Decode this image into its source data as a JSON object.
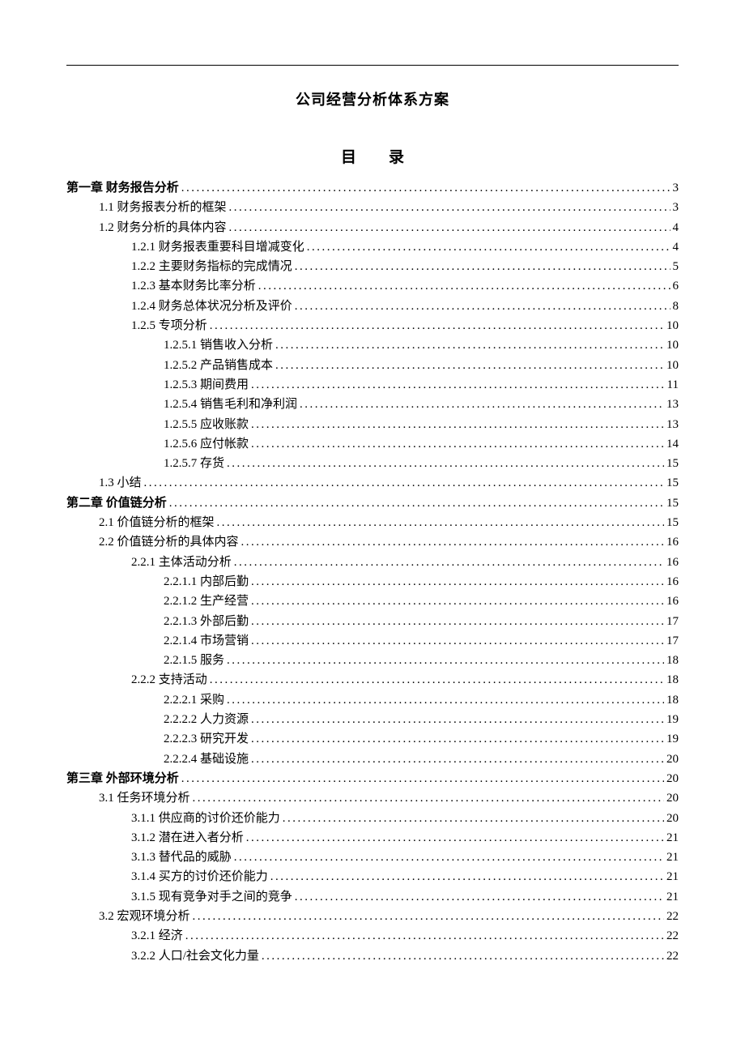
{
  "doc_title": "公司经营分析体系方案",
  "toc_heading_left": "目",
  "toc_heading_right": "录",
  "entries": [
    {
      "level": 0,
      "chap": true,
      "label": "第一章 财务报告分析",
      "page": "3"
    },
    {
      "level": 1,
      "chap": false,
      "label": "1.1 财务报表分析的框架",
      "page": "3"
    },
    {
      "level": 1,
      "chap": false,
      "label": "1.2 财务分析的具体内容",
      "page": "4"
    },
    {
      "level": 2,
      "chap": false,
      "label": "1.2.1 财务报表重要科目增减变化",
      "page": "4"
    },
    {
      "level": 2,
      "chap": false,
      "label": "1.2.2 主要财务指标的完成情况",
      "page": "5"
    },
    {
      "level": 2,
      "chap": false,
      "label": "1.2.3 基本财务比率分析",
      "page": "6"
    },
    {
      "level": 2,
      "chap": false,
      "label": "1.2.4 财务总体状况分析及评价",
      "page": "8"
    },
    {
      "level": 2,
      "chap": false,
      "label": "1.2.5 专项分析",
      "page": "10"
    },
    {
      "level": 3,
      "chap": false,
      "label": "1.2.5.1 销售收入分析",
      "page": "10"
    },
    {
      "level": 3,
      "chap": false,
      "label": "1.2.5.2 产品销售成本",
      "page": "10"
    },
    {
      "level": 3,
      "chap": false,
      "label": "1.2.5.3 期间费用",
      "page": "11"
    },
    {
      "level": 3,
      "chap": false,
      "label": "1.2.5.4 销售毛利和净利润",
      "page": "13"
    },
    {
      "level": 3,
      "chap": false,
      "label": "1.2.5.5 应收账款",
      "page": "13"
    },
    {
      "level": 3,
      "chap": false,
      "label": "1.2.5.6 应付帐款",
      "page": "14"
    },
    {
      "level": 3,
      "chap": false,
      "label": "1.2.5.7 存货",
      "page": "15"
    },
    {
      "level": 1,
      "chap": false,
      "label": "1.3 小结",
      "page": "15"
    },
    {
      "level": 0,
      "chap": true,
      "label": "第二章 价值链分析",
      "page": "15"
    },
    {
      "level": 1,
      "chap": false,
      "label": "2.1 价值链分析的框架",
      "page": "15"
    },
    {
      "level": 1,
      "chap": false,
      "label": "2.2 价值链分析的具体内容",
      "page": "16"
    },
    {
      "level": 2,
      "chap": false,
      "label": "2.2.1 主体活动分析",
      "page": "16"
    },
    {
      "level": 3,
      "chap": false,
      "label": "2.2.1.1 内部后勤",
      "page": "16"
    },
    {
      "level": 3,
      "chap": false,
      "label": "2.2.1.2 生产经营",
      "page": "16"
    },
    {
      "level": 3,
      "chap": false,
      "label": "2.2.1.3 外部后勤",
      "page": "17"
    },
    {
      "level": 3,
      "chap": false,
      "label": "2.2.1.4 市场营销",
      "page": "17"
    },
    {
      "level": 3,
      "chap": false,
      "label": "2.2.1.5 服务",
      "page": "18"
    },
    {
      "level": 2,
      "chap": false,
      "label": "2.2.2 支持活动",
      "page": "18"
    },
    {
      "level": 3,
      "chap": false,
      "label": "2.2.2.1 采购",
      "page": "18"
    },
    {
      "level": 3,
      "chap": false,
      "label": "2.2.2.2 人力资源",
      "page": "19"
    },
    {
      "level": 3,
      "chap": false,
      "label": "2.2.2.3 研究开发",
      "page": "19"
    },
    {
      "level": 3,
      "chap": false,
      "label": "2.2.2.4 基础设施",
      "page": "20"
    },
    {
      "level": 0,
      "chap": true,
      "label": "第三章 外部环境分析",
      "page": "20"
    },
    {
      "level": 1,
      "chap": false,
      "label": "3.1 任务环境分析",
      "page": "20"
    },
    {
      "level": 2,
      "chap": false,
      "label": "3.1.1 供应商的讨价还价能力",
      "page": "20"
    },
    {
      "level": 2,
      "chap": false,
      "label": "3.1.2 潜在进入者分析",
      "page": "21"
    },
    {
      "level": 2,
      "chap": false,
      "label": "3.1.3 替代品的威胁",
      "page": "21"
    },
    {
      "level": 2,
      "chap": false,
      "label": "3.1.4 买方的讨价还价能力",
      "page": "21"
    },
    {
      "level": 2,
      "chap": false,
      "label": "3.1.5 现有竞争对手之间的竞争",
      "page": "21"
    },
    {
      "level": 1,
      "chap": false,
      "label": "3.2 宏观环境分析",
      "page": "22"
    },
    {
      "level": 2,
      "chap": false,
      "label": "3.2.1 经济",
      "page": "22"
    },
    {
      "level": 2,
      "chap": false,
      "label": "3.2.2 人口/社会文化力量",
      "page": "22"
    }
  ]
}
